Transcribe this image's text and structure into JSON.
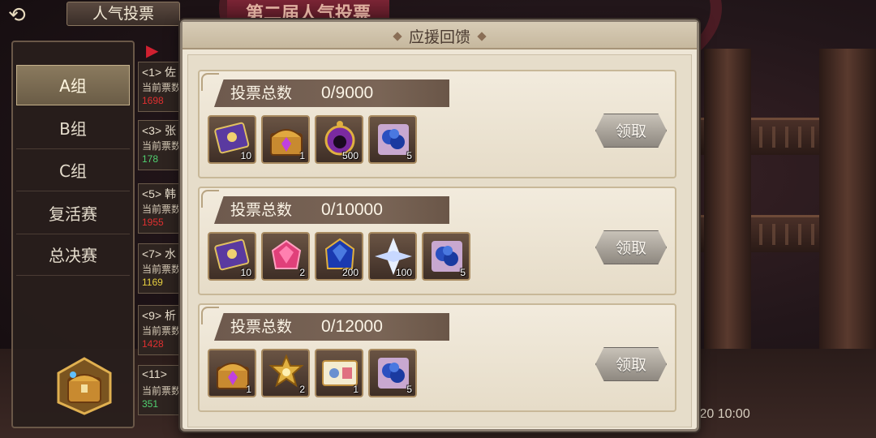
{
  "header": {
    "back_label": "⟲",
    "title": "人气投票",
    "banner": "第二届人气投票"
  },
  "sidebar": {
    "items": [
      {
        "label": "A组",
        "active": true
      },
      {
        "label": "B组",
        "active": false
      },
      {
        "label": "C组",
        "active": false
      },
      {
        "label": "复活赛",
        "active": false
      },
      {
        "label": "总决赛",
        "active": false
      }
    ]
  },
  "list": {
    "rows": [
      {
        "rank": "<1> 佐",
        "current": "当前票数",
        "votes": "1698",
        "votes_color": "#e03030"
      },
      {
        "rank": "<3> 张",
        "current": "当前票数",
        "votes": "178",
        "votes_color": "#50d070"
      },
      {
        "rank": "<5> 韩",
        "current": "当前票数",
        "votes": "1955",
        "votes_color": "#e03030"
      },
      {
        "rank": "<7> 水",
        "current": "当前票数",
        "votes": "1169",
        "votes_color": "#e8d040"
      },
      {
        "rank": "<9> 析",
        "current": "当前票数",
        "votes": "1428",
        "votes_color": "#e03030"
      },
      {
        "rank": "<11>",
        "current": "当前票数",
        "votes": "351",
        "votes_color": "#50d070"
      }
    ]
  },
  "dialog": {
    "title": "应援回馈",
    "rewards": [
      {
        "label": "投票总数",
        "count": "0/9000",
        "claim_label": "领取",
        "items": [
          {
            "icon": "card-icon",
            "qty": "10"
          },
          {
            "icon": "treasure-chest-icon",
            "qty": "1"
          },
          {
            "icon": "purple-orb-icon",
            "qty": "500"
          },
          {
            "icon": "blue-crystal-cluster-icon",
            "qty": "5"
          }
        ]
      },
      {
        "label": "投票总数",
        "count": "0/10000",
        "claim_label": "领取",
        "items": [
          {
            "icon": "card-icon",
            "qty": "10"
          },
          {
            "icon": "pink-gem-icon",
            "qty": "2"
          },
          {
            "icon": "blue-gem-icon",
            "qty": "200"
          },
          {
            "icon": "white-crystal-icon",
            "qty": "100"
          },
          {
            "icon": "blue-crystal-cluster-icon",
            "qty": "5"
          }
        ]
      },
      {
        "label": "投票总数",
        "count": "0/12000",
        "claim_label": "领取",
        "items": [
          {
            "icon": "treasure-chest-icon",
            "qty": "1"
          },
          {
            "icon": "gold-emblem-icon",
            "qty": "2"
          },
          {
            "icon": "ticket-icon",
            "qty": "1"
          },
          {
            "icon": "blue-crystal-cluster-icon",
            "qty": "5"
          }
        ]
      }
    ]
  },
  "footer": {
    "date": ".20 10:00"
  },
  "colors": {
    "dialog_bg": "#eee6d6",
    "label_bg": "#6e5a4e",
    "claim_button": "#a8a298"
  }
}
